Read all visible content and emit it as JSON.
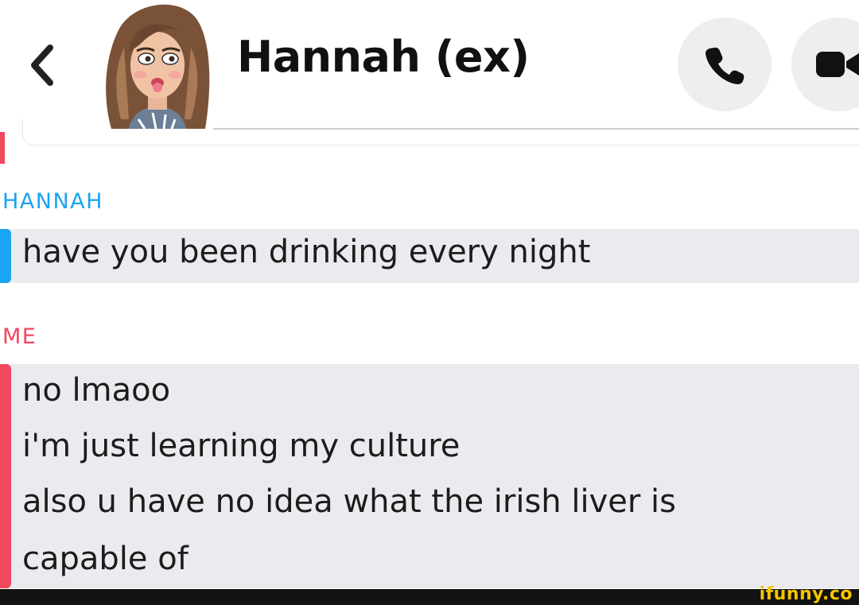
{
  "header": {
    "title": "Hannah (ex)",
    "back_icon": "chevron-left-icon",
    "call_icon": "phone-icon",
    "video_icon": "video-camera-icon"
  },
  "messages": [
    {
      "sender": "HANNAH",
      "color": "#1aa4f1",
      "lines": [
        "have you been drinking every night"
      ]
    },
    {
      "sender": "ME",
      "color": "#f2475d",
      "lines": [
        "no lmaoo",
        "i'm just learning my culture",
        "also u have no idea what the irish liver is",
        "capable of"
      ]
    }
  ],
  "footer": {
    "watermark": "ifunny.co"
  }
}
